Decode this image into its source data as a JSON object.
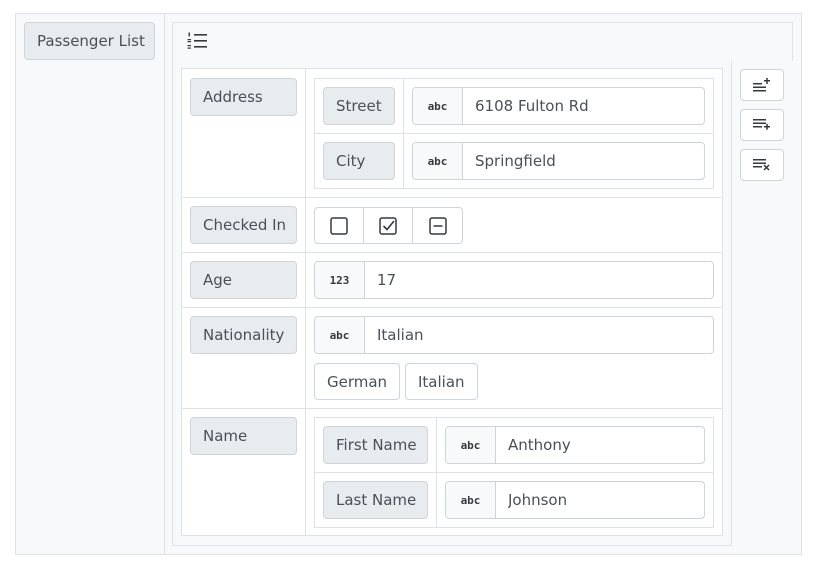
{
  "sidebar": {
    "passenger_list_label": "Passenger List"
  },
  "toolbar": {
    "list_icon": "list-ordered-icon"
  },
  "actions": {
    "icons": [
      "insert-above-icon",
      "insert-below-icon",
      "delete-row-icon"
    ]
  },
  "fields": {
    "address": {
      "label": "Address",
      "street": {
        "label": "Street",
        "type_badge": "abc",
        "value": "6108 Fulton Rd"
      },
      "city": {
        "label": "City",
        "type_badge": "abc",
        "value": "Springfield"
      }
    },
    "checked_in": {
      "label": "Checked In",
      "options": [
        "unchecked-box-icon",
        "checked-box-icon",
        "indeterminate-box-icon"
      ]
    },
    "age": {
      "label": "Age",
      "type_badge": "123",
      "value": "17"
    },
    "nationality": {
      "label": "Nationality",
      "type_badge": "abc",
      "value": "Italian",
      "suggestions": [
        "German",
        "Italian"
      ]
    },
    "name": {
      "label": "Name",
      "first_name": {
        "label": "First Name",
        "type_badge": "abc",
        "value": "Anthony"
      },
      "last_name": {
        "label": "Last Name",
        "type_badge": "abc",
        "value": "Johnson"
      }
    }
  }
}
